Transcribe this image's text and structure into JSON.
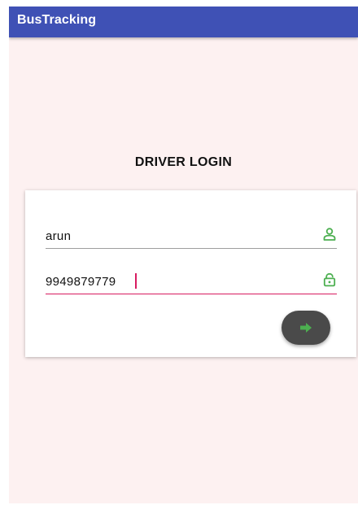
{
  "app_bar": {
    "title": "BusTracking"
  },
  "login": {
    "heading": "DRIVER LOGIN",
    "username": {
      "value": "arun",
      "icon": "person-outline-icon"
    },
    "password": {
      "value": "9949879779",
      "icon": "lock-open-icon"
    },
    "submit": {
      "icon": "arrow-right-icon"
    }
  },
  "colors": {
    "app_bar": "#3f51b5",
    "background": "#fdf1f1",
    "icon_green": "#4caf50",
    "focus_underline": "#d81b60",
    "fab": "#4a4a4a"
  }
}
